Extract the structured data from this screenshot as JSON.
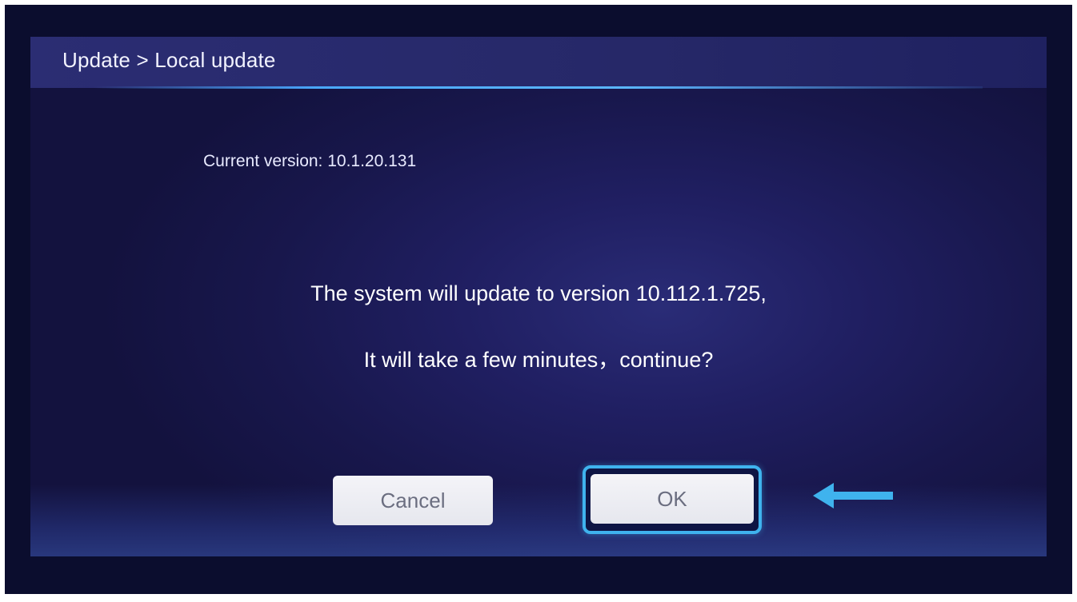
{
  "header": {
    "title": "Update > Local update"
  },
  "current_version": {
    "text": "Current version: 10.1.20.131"
  },
  "message": {
    "line1": "The system will update to version 10.112.1.725,",
    "line2": "It will take a few minutes，continue?"
  },
  "buttons": {
    "cancel_label": "Cancel",
    "ok_label": "OK"
  },
  "annotation": {
    "arrow_icon": "left-arrow-icon",
    "color": "#3fb3ee"
  },
  "colors": {
    "focus_ring": "#3fb3ee",
    "header_line": "#4aa8ff",
    "background": "#18174c"
  }
}
